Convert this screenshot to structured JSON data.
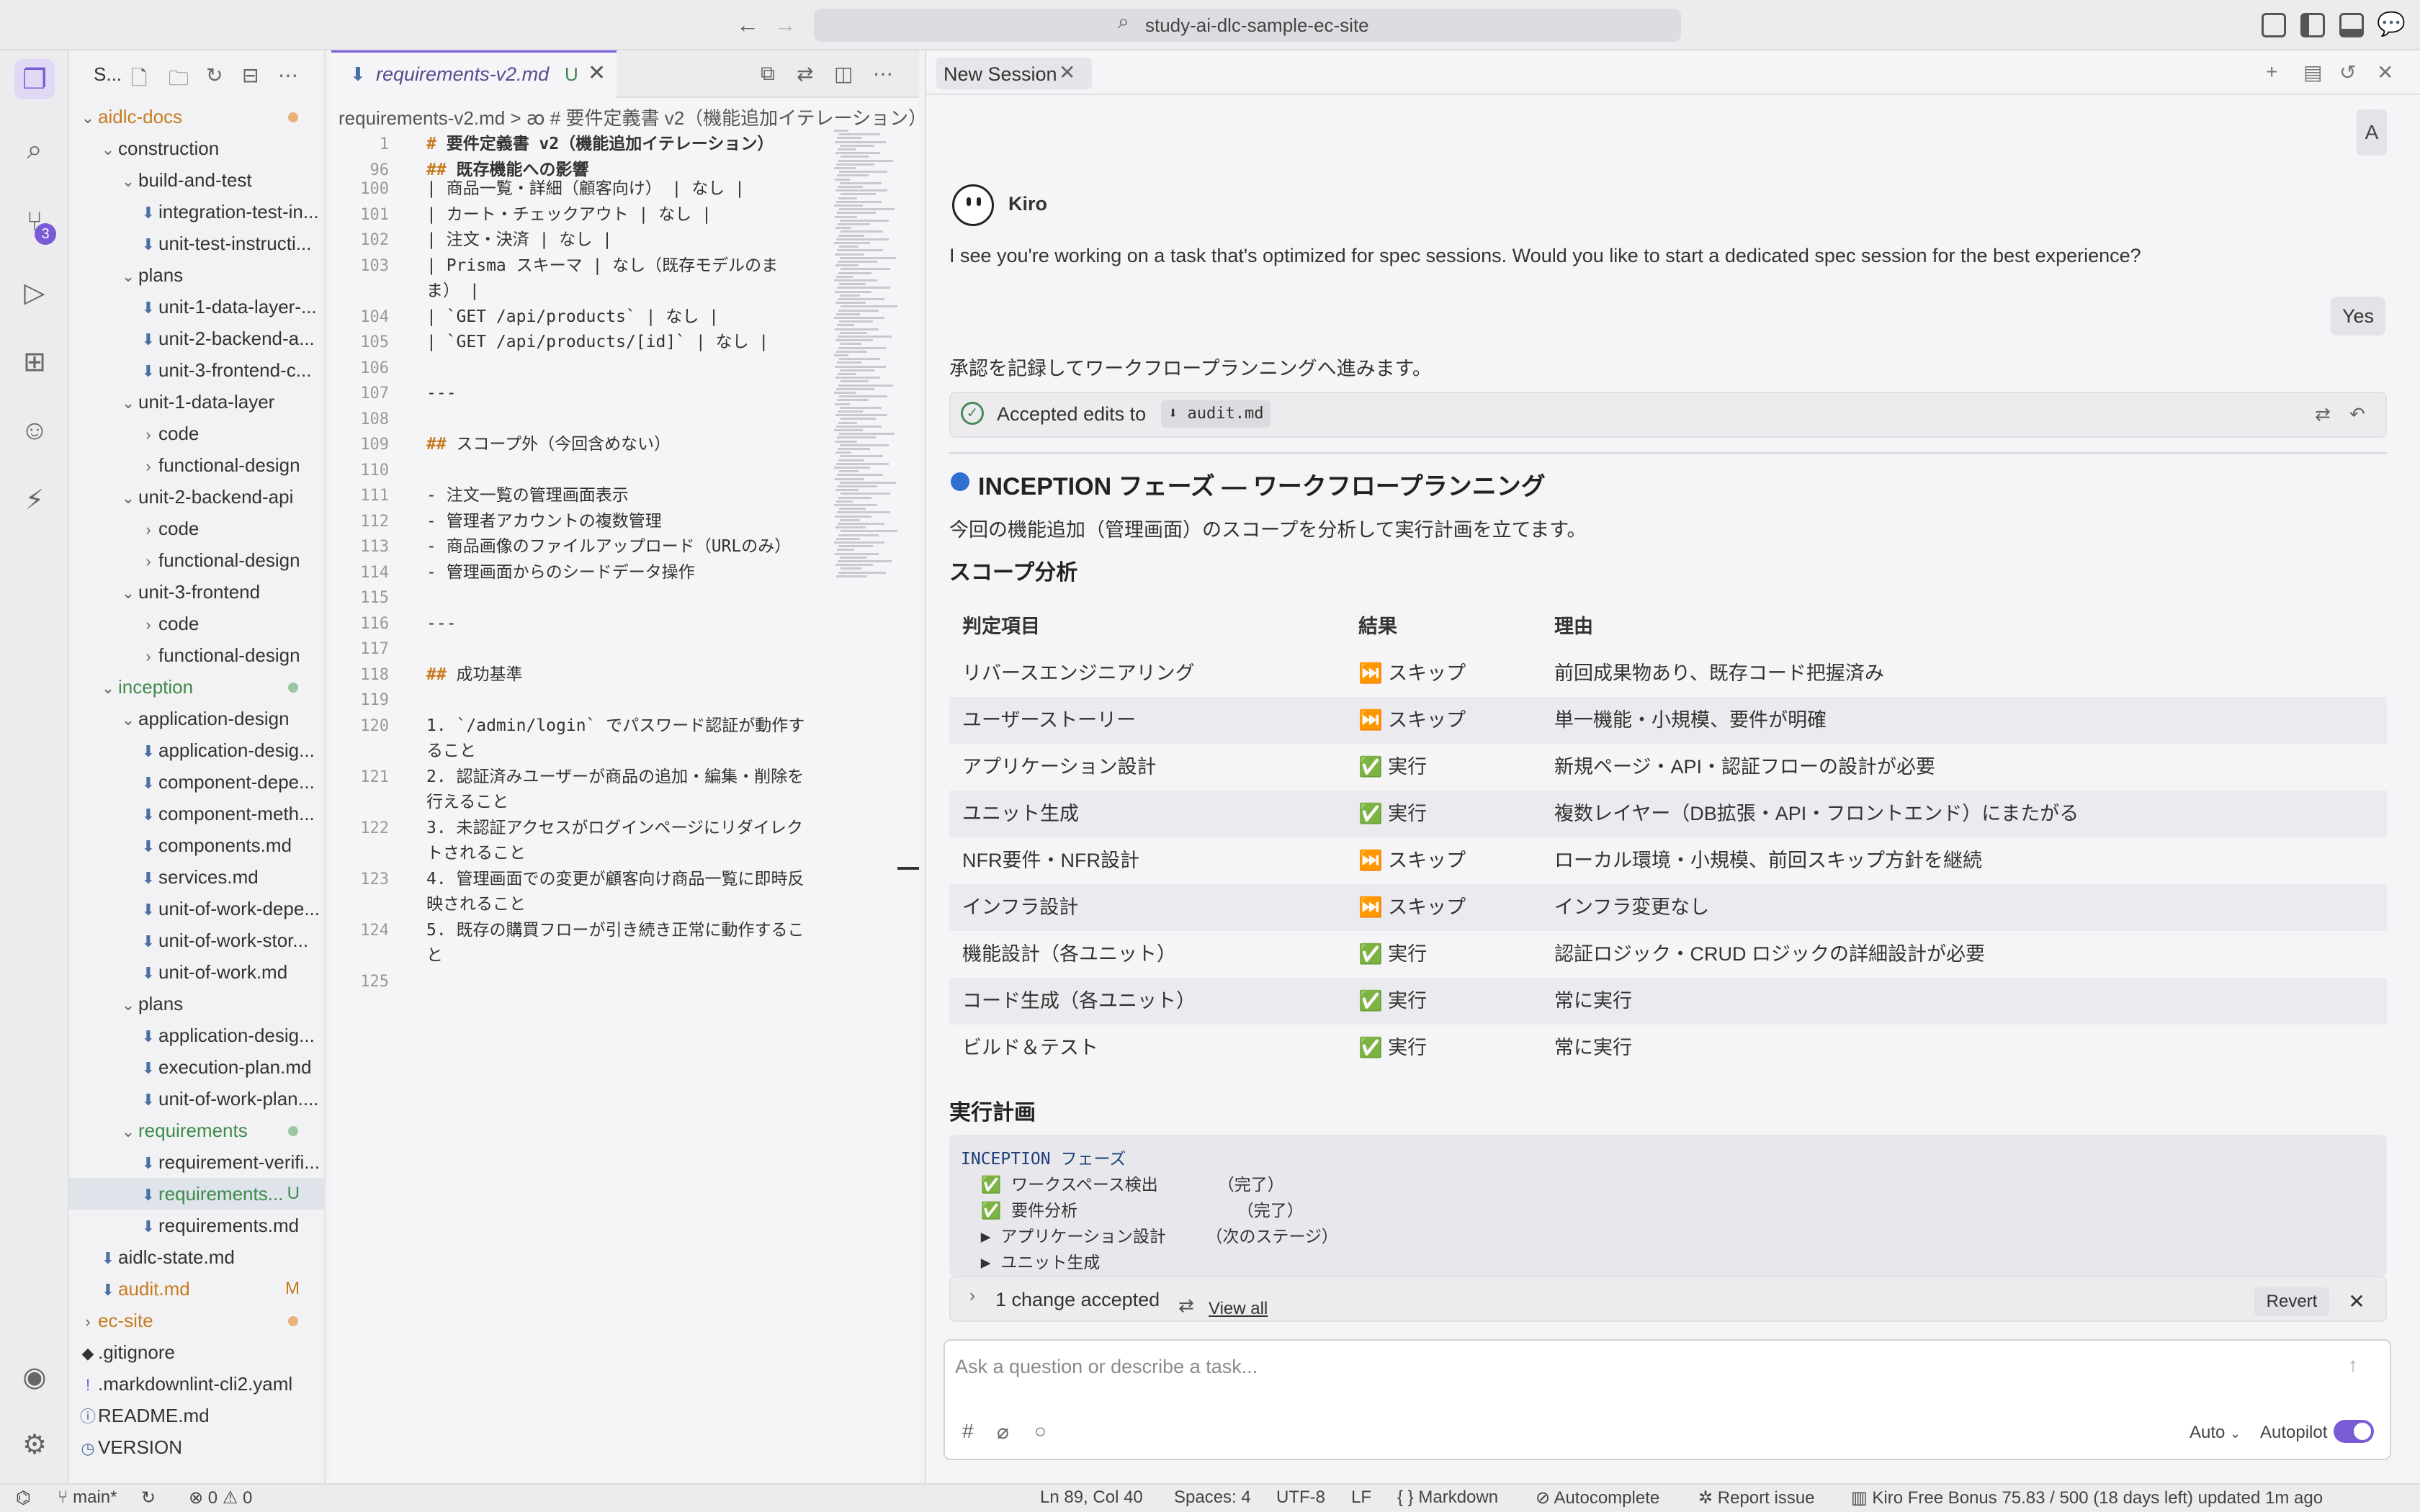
{
  "window": {
    "title": "study-ai-dlc-sample-ec-site",
    "accent_color": "#7a5bd6"
  },
  "activity_bar": {
    "icons": [
      "explorer-icon",
      "search-icon",
      "source-control-icon",
      "run-debug-icon",
      "extensions-icon",
      "kiro-ghost-icon",
      "kiro-spec-icon",
      "account-icon",
      "settings-icon"
    ],
    "source_control_badge": "3"
  },
  "sidebar": {
    "title": "S...",
    "tree": [
      {
        "name": "aidlc-docs",
        "type": "folder",
        "indent": 0,
        "open": true,
        "color": "orange",
        "dot": "orange"
      },
      {
        "name": "construction",
        "type": "folder",
        "indent": 1,
        "open": true
      },
      {
        "name": "build-and-test",
        "type": "folder",
        "indent": 2,
        "open": true
      },
      {
        "name": "integration-test-in...",
        "type": "file",
        "indent": 3
      },
      {
        "name": "unit-test-instructi...",
        "type": "file",
        "indent": 3
      },
      {
        "name": "plans",
        "type": "folder",
        "indent": 2,
        "open": true
      },
      {
        "name": "unit-1-data-layer-...",
        "type": "file",
        "indent": 3
      },
      {
        "name": "unit-2-backend-a...",
        "type": "file",
        "indent": 3
      },
      {
        "name": "unit-3-frontend-c...",
        "type": "file",
        "indent": 3
      },
      {
        "name": "unit-1-data-layer",
        "type": "folder",
        "indent": 2,
        "open": true
      },
      {
        "name": "code",
        "type": "folder",
        "indent": 3,
        "open": false
      },
      {
        "name": "functional-design",
        "type": "folder",
        "indent": 3,
        "open": false
      },
      {
        "name": "unit-2-backend-api",
        "type": "folder",
        "indent": 2,
        "open": true
      },
      {
        "name": "code",
        "type": "folder",
        "indent": 3,
        "open": false
      },
      {
        "name": "functional-design",
        "type": "folder",
        "indent": 3,
        "open": false
      },
      {
        "name": "unit-3-frontend",
        "type": "folder",
        "indent": 2,
        "open": true
      },
      {
        "name": "code",
        "type": "folder",
        "indent": 3,
        "open": false
      },
      {
        "name": "functional-design",
        "type": "folder",
        "indent": 3,
        "open": false
      },
      {
        "name": "inception",
        "type": "folder",
        "indent": 1,
        "open": true,
        "color": "green",
        "dot": "green"
      },
      {
        "name": "application-design",
        "type": "folder",
        "indent": 2,
        "open": true
      },
      {
        "name": "application-desig...",
        "type": "file",
        "indent": 3
      },
      {
        "name": "component-depe...",
        "type": "file",
        "indent": 3
      },
      {
        "name": "component-meth...",
        "type": "file",
        "indent": 3
      },
      {
        "name": "components.md",
        "type": "file",
        "indent": 3
      },
      {
        "name": "services.md",
        "type": "file",
        "indent": 3
      },
      {
        "name": "unit-of-work-depe...",
        "type": "file",
        "indent": 3
      },
      {
        "name": "unit-of-work-stor...",
        "type": "file",
        "indent": 3
      },
      {
        "name": "unit-of-work.md",
        "type": "file",
        "indent": 3
      },
      {
        "name": "plans",
        "type": "folder",
        "indent": 2,
        "open": true
      },
      {
        "name": "application-desig...",
        "type": "file",
        "indent": 3
      },
      {
        "name": "execution-plan.md",
        "type": "file",
        "indent": 3
      },
      {
        "name": "unit-of-work-plan....",
        "type": "file",
        "indent": 3
      },
      {
        "name": "requirements",
        "type": "folder",
        "indent": 2,
        "open": true,
        "color": "green",
        "dot": "green"
      },
      {
        "name": "requirement-verifi...",
        "type": "file",
        "indent": 3
      },
      {
        "name": "requirements...",
        "type": "file",
        "indent": 3,
        "status": "U",
        "color": "green",
        "selected": true
      },
      {
        "name": "requirements.md",
        "type": "file",
        "indent": 3
      },
      {
        "name": "aidlc-state.md",
        "type": "file",
        "indent": 1
      },
      {
        "name": "audit.md",
        "type": "file",
        "indent": 1,
        "status": "M",
        "color": "orange"
      },
      {
        "name": "ec-site",
        "type": "folder",
        "indent": 0,
        "open": false,
        "color": "orange",
        "dot": "orange"
      },
      {
        "name": ".gitignore",
        "type": "dotfile",
        "indent": 0
      },
      {
        "name": ".markdownlint-cli2.yaml",
        "type": "yaml",
        "indent": 0
      },
      {
        "name": "README.md",
        "type": "info",
        "indent": 0
      },
      {
        "name": "VERSION",
        "type": "version",
        "indent": 0
      }
    ]
  },
  "editor": {
    "tab_name": "requirements-v2.md",
    "tab_status": "U",
    "breadcrumb": "requirements-v2.md > ꜵ # 要件定義書 v2（機能追加イテレーション）",
    "sticky": [
      {
        "n": "1",
        "text": "# 要件定義書 v2（機能追加イテレーション）",
        "kind": "h"
      },
      {
        "n": "96",
        "text": "## 既存機能への影響",
        "kind": "h"
      }
    ],
    "lines": [
      {
        "n": "100",
        "text": "| 商品一覧・詳細（顧客向け） | なし |"
      },
      {
        "n": "101",
        "text": "| カート・チェックアウト | なし |"
      },
      {
        "n": "102",
        "text": "| 注文・決済 | なし |"
      },
      {
        "n": "103",
        "text": "| Prisma スキーマ | なし（既存モデルのま"
      },
      {
        "n": "",
        "text": "ま） |"
      },
      {
        "n": "104",
        "text": "| `GET /api/products` | なし |"
      },
      {
        "n": "105",
        "text": "| `GET /api/products/[id]` | なし |"
      },
      {
        "n": "106",
        "text": ""
      },
      {
        "n": "107",
        "text": "---"
      },
      {
        "n": "108",
        "text": ""
      },
      {
        "n": "109",
        "text": "## スコープ外（今回含めない）",
        "kind": "h2"
      },
      {
        "n": "110",
        "text": ""
      },
      {
        "n": "111",
        "text": "- 注文一覧の管理画面表示"
      },
      {
        "n": "112",
        "text": "- 管理者アカウントの複数管理"
      },
      {
        "n": "113",
        "text": "- 商品画像のファイルアップロード（URLのみ）"
      },
      {
        "n": "114",
        "text": "- 管理画面からのシードデータ操作"
      },
      {
        "n": "115",
        "text": ""
      },
      {
        "n": "116",
        "text": "---"
      },
      {
        "n": "117",
        "text": ""
      },
      {
        "n": "118",
        "text": "## 成功基準",
        "kind": "h2"
      },
      {
        "n": "119",
        "text": ""
      },
      {
        "n": "120",
        "text": "1. `/admin/login` でパスワード認証が動作す"
      },
      {
        "n": "",
        "text": "ること"
      },
      {
        "n": "121",
        "text": "2. 認証済みユーザーが商品の追加・編集・削除を"
      },
      {
        "n": "",
        "text": "行えること"
      },
      {
        "n": "122",
        "text": "3. 未認証アクセスがログインページにリダイレク"
      },
      {
        "n": "",
        "text": "トされること"
      },
      {
        "n": "123",
        "text": "4. 管理画面での変更が顧客向け商品一覧に即時反"
      },
      {
        "n": "",
        "text": "映されること"
      },
      {
        "n": "124",
        "text": "5. 既存の購買フローが引き続き正常に動作するこ"
      },
      {
        "n": "",
        "text": "と"
      },
      {
        "n": "125",
        "text": ""
      }
    ]
  },
  "chat": {
    "tab_name": "New Session",
    "user_avatar": "A",
    "agent_name": "Kiro",
    "agent_message": "I see you're working on a task that's optimized for spec sessions. Would you like to start a dedicated spec session for the best experience?",
    "user_reply": "Yes",
    "agent_note": "承認を記録してワークフロープランニングへ進みます。",
    "accepted_label": "Accepted edits to",
    "accepted_file": "audit.md",
    "phase_title": "INCEPTION フェーズ — ワークフロープランニング",
    "phase_desc": "今回の機能追加（管理画面）のスコープを分析して実行計画を立てます。",
    "scope_heading": "スコープ分析",
    "table_headers": [
      "判定項目",
      "結果",
      "理由"
    ],
    "table_rows": [
      [
        "リバースエンジニアリング",
        "⏭️ スキップ",
        "前回成果物あり、既存コード把握済み"
      ],
      [
        "ユーザーストーリー",
        "⏭️ スキップ",
        "単一機能・小規模、要件が明確"
      ],
      [
        "アプリケーション設計",
        "✅ 実行",
        "新規ページ・API・認証フローの設計が必要"
      ],
      [
        "ユニット生成",
        "✅ 実行",
        "複数レイヤー（DB拡張・API・フロントエンド）にまたがる"
      ],
      [
        "NFR要件・NFR設計",
        "⏭️ スキップ",
        "ローカル環境・小規模、前回スキップ方針を継続"
      ],
      [
        "インフラ設計",
        "⏭️ スキップ",
        "インフラ変更なし"
      ],
      [
        "機能設計（各ユニット）",
        "✅ 実行",
        "認証ロジック・CRUD ロジックの詳細設計が必要"
      ],
      [
        "コード生成（各ユニット）",
        "✅ 実行",
        "常に実行"
      ],
      [
        "ビルド＆テスト",
        "✅ 実行",
        "常に実行"
      ]
    ],
    "plan_heading": "実行計画",
    "plan_lines": [
      "INCEPTION フェーズ",
      "  ✅ ワークスペース検出      （完了）",
      "  ✅ 要件分析                （完了）",
      "  ▶ アプリケーション設計    （次のステージ）",
      "  ▶ ユニット生成"
    ],
    "changes_text": "1 change accepted",
    "view_all": "View all",
    "revert": "Revert",
    "input_placeholder": "Ask a question or describe a task...",
    "mode": "Auto",
    "autopilot": "Autopilot"
  },
  "statusbar": {
    "branch": "main*",
    "errors": "0",
    "warnings": "0",
    "position": "Ln 89, Col 40",
    "spaces": "Spaces: 4",
    "encoding": "UTF-8",
    "eol": "LF",
    "language": "Markdown",
    "autocomplete": "Autocomplete",
    "report": "Report issue",
    "bonus": "Kiro Free Bonus 75.83 / 500 (18 days left) updated 1m ago"
  }
}
